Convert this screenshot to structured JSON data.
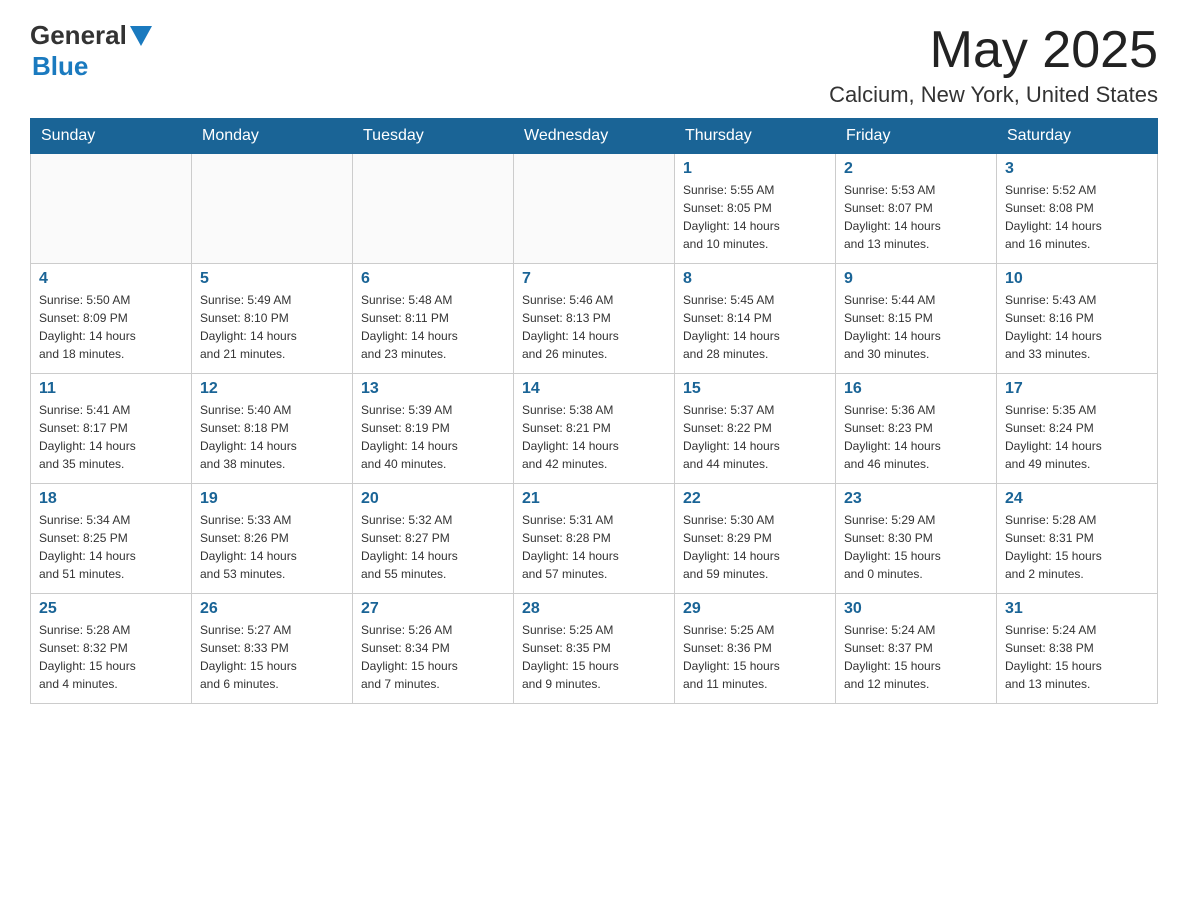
{
  "header": {
    "logo_general": "General",
    "logo_blue": "Blue",
    "month_year": "May 2025",
    "location": "Calcium, New York, United States"
  },
  "days_of_week": [
    "Sunday",
    "Monday",
    "Tuesday",
    "Wednesday",
    "Thursday",
    "Friday",
    "Saturday"
  ],
  "weeks": [
    [
      {
        "day": "",
        "info": ""
      },
      {
        "day": "",
        "info": ""
      },
      {
        "day": "",
        "info": ""
      },
      {
        "day": "",
        "info": ""
      },
      {
        "day": "1",
        "info": "Sunrise: 5:55 AM\nSunset: 8:05 PM\nDaylight: 14 hours\nand 10 minutes."
      },
      {
        "day": "2",
        "info": "Sunrise: 5:53 AM\nSunset: 8:07 PM\nDaylight: 14 hours\nand 13 minutes."
      },
      {
        "day": "3",
        "info": "Sunrise: 5:52 AM\nSunset: 8:08 PM\nDaylight: 14 hours\nand 16 minutes."
      }
    ],
    [
      {
        "day": "4",
        "info": "Sunrise: 5:50 AM\nSunset: 8:09 PM\nDaylight: 14 hours\nand 18 minutes."
      },
      {
        "day": "5",
        "info": "Sunrise: 5:49 AM\nSunset: 8:10 PM\nDaylight: 14 hours\nand 21 minutes."
      },
      {
        "day": "6",
        "info": "Sunrise: 5:48 AM\nSunset: 8:11 PM\nDaylight: 14 hours\nand 23 minutes."
      },
      {
        "day": "7",
        "info": "Sunrise: 5:46 AM\nSunset: 8:13 PM\nDaylight: 14 hours\nand 26 minutes."
      },
      {
        "day": "8",
        "info": "Sunrise: 5:45 AM\nSunset: 8:14 PM\nDaylight: 14 hours\nand 28 minutes."
      },
      {
        "day": "9",
        "info": "Sunrise: 5:44 AM\nSunset: 8:15 PM\nDaylight: 14 hours\nand 30 minutes."
      },
      {
        "day": "10",
        "info": "Sunrise: 5:43 AM\nSunset: 8:16 PM\nDaylight: 14 hours\nand 33 minutes."
      }
    ],
    [
      {
        "day": "11",
        "info": "Sunrise: 5:41 AM\nSunset: 8:17 PM\nDaylight: 14 hours\nand 35 minutes."
      },
      {
        "day": "12",
        "info": "Sunrise: 5:40 AM\nSunset: 8:18 PM\nDaylight: 14 hours\nand 38 minutes."
      },
      {
        "day": "13",
        "info": "Sunrise: 5:39 AM\nSunset: 8:19 PM\nDaylight: 14 hours\nand 40 minutes."
      },
      {
        "day": "14",
        "info": "Sunrise: 5:38 AM\nSunset: 8:21 PM\nDaylight: 14 hours\nand 42 minutes."
      },
      {
        "day": "15",
        "info": "Sunrise: 5:37 AM\nSunset: 8:22 PM\nDaylight: 14 hours\nand 44 minutes."
      },
      {
        "day": "16",
        "info": "Sunrise: 5:36 AM\nSunset: 8:23 PM\nDaylight: 14 hours\nand 46 minutes."
      },
      {
        "day": "17",
        "info": "Sunrise: 5:35 AM\nSunset: 8:24 PM\nDaylight: 14 hours\nand 49 minutes."
      }
    ],
    [
      {
        "day": "18",
        "info": "Sunrise: 5:34 AM\nSunset: 8:25 PM\nDaylight: 14 hours\nand 51 minutes."
      },
      {
        "day": "19",
        "info": "Sunrise: 5:33 AM\nSunset: 8:26 PM\nDaylight: 14 hours\nand 53 minutes."
      },
      {
        "day": "20",
        "info": "Sunrise: 5:32 AM\nSunset: 8:27 PM\nDaylight: 14 hours\nand 55 minutes."
      },
      {
        "day": "21",
        "info": "Sunrise: 5:31 AM\nSunset: 8:28 PM\nDaylight: 14 hours\nand 57 minutes."
      },
      {
        "day": "22",
        "info": "Sunrise: 5:30 AM\nSunset: 8:29 PM\nDaylight: 14 hours\nand 59 minutes."
      },
      {
        "day": "23",
        "info": "Sunrise: 5:29 AM\nSunset: 8:30 PM\nDaylight: 15 hours\nand 0 minutes."
      },
      {
        "day": "24",
        "info": "Sunrise: 5:28 AM\nSunset: 8:31 PM\nDaylight: 15 hours\nand 2 minutes."
      }
    ],
    [
      {
        "day": "25",
        "info": "Sunrise: 5:28 AM\nSunset: 8:32 PM\nDaylight: 15 hours\nand 4 minutes."
      },
      {
        "day": "26",
        "info": "Sunrise: 5:27 AM\nSunset: 8:33 PM\nDaylight: 15 hours\nand 6 minutes."
      },
      {
        "day": "27",
        "info": "Sunrise: 5:26 AM\nSunset: 8:34 PM\nDaylight: 15 hours\nand 7 minutes."
      },
      {
        "day": "28",
        "info": "Sunrise: 5:25 AM\nSunset: 8:35 PM\nDaylight: 15 hours\nand 9 minutes."
      },
      {
        "day": "29",
        "info": "Sunrise: 5:25 AM\nSunset: 8:36 PM\nDaylight: 15 hours\nand 11 minutes."
      },
      {
        "day": "30",
        "info": "Sunrise: 5:24 AM\nSunset: 8:37 PM\nDaylight: 15 hours\nand 12 minutes."
      },
      {
        "day": "31",
        "info": "Sunrise: 5:24 AM\nSunset: 8:38 PM\nDaylight: 15 hours\nand 13 minutes."
      }
    ]
  ]
}
